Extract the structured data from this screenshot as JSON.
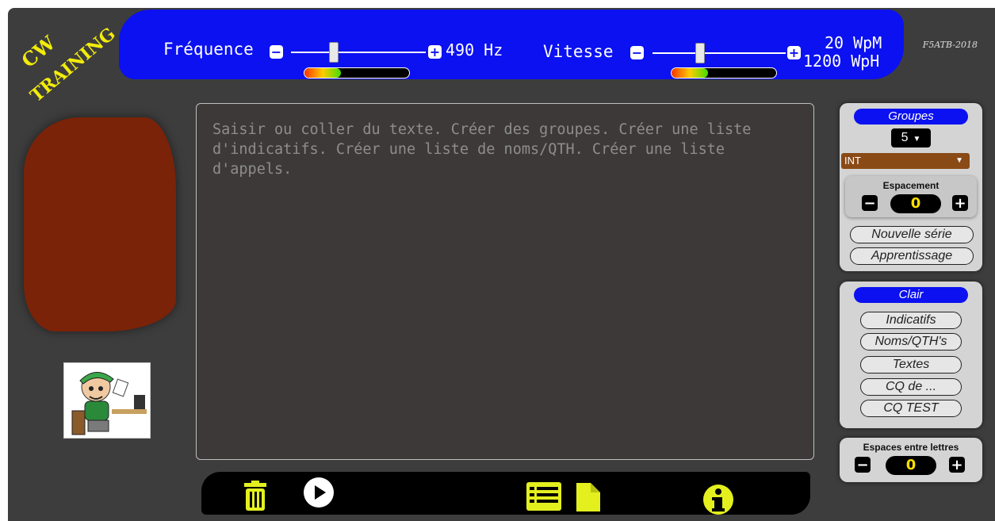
{
  "logo": {
    "line1": "CW",
    "line2": "TRAINING"
  },
  "frequency": {
    "label": "Fréquence",
    "minus": "−",
    "plus": "+",
    "value": "490 Hz",
    "slider_level": 0.33,
    "meter_level": 0.35
  },
  "speed": {
    "label": "Vitesse",
    "minus": "−",
    "plus": "+",
    "wpm": "20 WpM",
    "wph": "1200 WpH",
    "slider_level": 0.4,
    "meter_level": 0.35
  },
  "author": "F5ATB-2018",
  "editor": {
    "placeholder": "Saisir ou coller du texte. Créer des groupes. Créer une liste d'indicatifs. Créer une liste de noms/QTH. Créer une liste d'appels."
  },
  "groups_panel": {
    "title": "Groupes",
    "count_value": "5",
    "type_value": "INT",
    "spacing_label": "Espacement",
    "spacing_value": "0",
    "minus": "−",
    "plus": "+",
    "new_series": "Nouvelle série",
    "learning": "Apprentissage"
  },
  "clear_panel": {
    "title": "Clair",
    "buttons": [
      "Indicatifs",
      "Noms/QTH's",
      "Textes",
      "CQ de ...",
      "CQ TEST"
    ]
  },
  "letter_spacing_panel": {
    "label": "Espaces entre lettres",
    "value": "0",
    "minus": "−",
    "plus": "+"
  },
  "bottom_bar": {
    "icons": [
      "trash-icon",
      "play-icon",
      "list-icon",
      "file-icon",
      "info-icon"
    ]
  },
  "colors": {
    "accent_blue": "#0b11f0",
    "yellow": "#f2ec0a",
    "icon_yellow": "#e4f01e",
    "blob": "#7a2308"
  }
}
